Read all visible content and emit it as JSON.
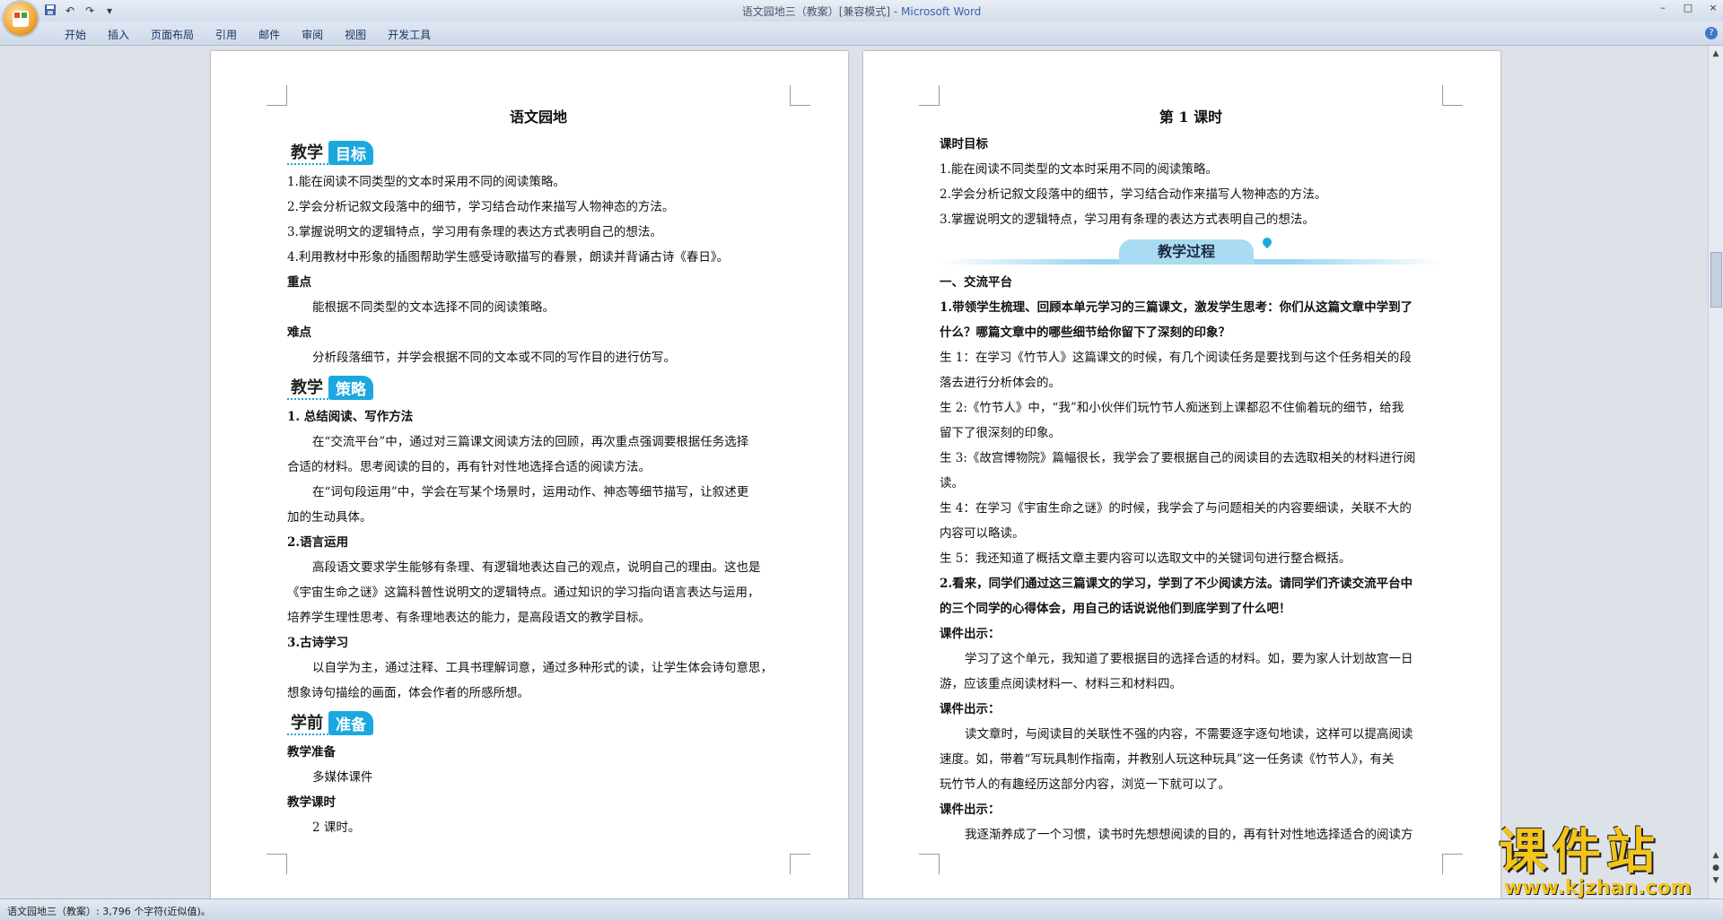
{
  "window": {
    "title_doc": "语文园地三（教案）[兼容模式] - ",
    "title_app": "Microsoft Word",
    "min": "–",
    "max": "□",
    "close": "×"
  },
  "quick_access": {
    "save_icon": "save-icon",
    "undo_icon": "undo-icon",
    "redo_icon": "redo-icon",
    "more": "▾"
  },
  "ribbon": {
    "tabs": [
      "开始",
      "插入",
      "页面布局",
      "引用",
      "邮件",
      "审阅",
      "视图",
      "开发工具"
    ],
    "help": "?"
  },
  "page1": {
    "title": "语文园地",
    "goal_banner": {
      "a": "教学",
      "b": "目标"
    },
    "goals": [
      "1.能在阅读不同类型的文本时采用不同的阅读策略。",
      "2.学会分析记叙文段落中的细节，学习结合动作来描写人物神态的方法。",
      "3.掌握说明文的逻辑特点，学习用有条理的表达方式表明自己的想法。",
      "4.利用教材中形象的插图帮助学生感受诗歌描写的春景，朗读并背诵古诗《春日》。"
    ],
    "key_label": "重点",
    "key_text": "能根据不同类型的文本选择不同的阅读策略。",
    "hard_label": "难点",
    "hard_text": "分析段落细节，并学会根据不同的文本或不同的写作目的进行仿写。",
    "strategy_banner": {
      "a": "教学",
      "b": "策略"
    },
    "s1_title": "1.  总结阅读、写作方法",
    "s1_p1a": "在“交流平台”中，通过对三篇课文阅读方法的回顾，再次重点强调要根据任务选择",
    "s1_p1b": "合适的材料。思考阅读的目的，再有针对性地选择合适的阅读方法。",
    "s1_p2a": "在“词句段运用”中，学会在写某个场景时，运用动作、神态等细节描写，让叙述更",
    "s1_p2b": "加的生动具体。",
    "s2_title": "2.语言运用",
    "s2_p1": "高段语文要求学生能够有条理、有逻辑地表达自己的观点，说明自己的理由。这也是",
    "s2_p2": "《宇宙生命之谜》这篇科普性说明文的逻辑特点。通过知识的学习指向语言表达与运用，",
    "s2_p3": "培养学生理性思考、有条理地表达的能力，是高段语文的教学目标。",
    "s3_title": "3.古诗学习",
    "s3_p1": "以自学为主，通过注释、工具书理解词意，通过多种形式的读，让学生体会诗句意思，",
    "s3_p2": "想象诗句描绘的画面，体会作者的所感所想。",
    "prep_banner": {
      "a": "学前",
      "b": "准备"
    },
    "prep_label": "教学准备",
    "prep_text": "多媒体课件",
    "hours_label": "教学课时",
    "hours_text": "2 课时。"
  },
  "page2": {
    "title": "第 1 课时",
    "goal_label": "课时目标",
    "goals": [
      "1.能在阅读不同类型的文本时采用不同的阅读策略。",
      "2.学会分析记叙文段落中的细节，学习结合动作来描写人物神态的方法。",
      "3.掌握说明文的逻辑特点，学习用有条理的表达方式表明自己的想法。"
    ],
    "process_banner": "教学过程",
    "sec1": "一、交流平台",
    "q1a": "1.带领学生梳理、回顾本单元学习的三篇课文，激发学生思考：你们从这篇文章中学到了",
    "q1b": "什么？哪篇文章中的哪些细节给你留下了深刻的印象？",
    "s1a": "生 1：在学习《竹节人》这篇课文的时候，有几个阅读任务是要找到与这个任务相关的段",
    "s1b": "落去进行分析体会的。",
    "s2a": "生 2:《竹节人》中，“我”和小伙伴们玩竹节人痴迷到上课都忍不住偷着玩的细节，给我",
    "s2b": "留下了很深刻的印象。",
    "s3a": "生 3:《故宫博物院》篇幅很长，我学会了要根据自己的阅读目的去选取相关的材料进行阅",
    "s3b": "读。",
    "s4a": "生 4：在学习《宇宙生命之谜》的时候，我学会了与问题相关的内容要细读，关联不大的",
    "s4b": "内容可以略读。",
    "s5": "生 5：我还知道了概括文章主要内容可以选取文中的关键词句进行整合概括。",
    "q2a": "2.看来，同学们通过这三篇课文的学习，学到了不少阅读方法。请同学们齐读交流平台中",
    "q2b": "的三个同学的心得体会，用自己的话说说他们到底学到了什么吧！",
    "show1": "课件出示：",
    "show1a": "学习了这个单元，我知道了要根据目的选择合适的材料。如，要为家人计划故宫一日",
    "show1b": "游，应该重点阅读材料一、材料三和材料四。",
    "show2": "课件出示：",
    "show2a": "读文章时，与阅读目的关联性不强的内容，不需要逐字逐句地读，这样可以提高阅读",
    "show2b": "速度。如，带着“写玩具制作指南，并教别人玩这种玩具”这一任务读《竹节人》，有关",
    "show2c": "玩竹节人的有趣经历这部分内容，浏览一下就可以了。",
    "show3": "课件出示：",
    "show3a": "我逐渐养成了一个习惯，读书时先想想阅读的目的，再有针对性地选择适合的阅读方"
  },
  "status": {
    "text": "语文园地三（教案）: 3,796 个字符(近似值)。"
  },
  "watermark": {
    "cn": "课件站",
    "url": "www.kjzhan.com"
  },
  "colors": {
    "accent": "#1ba8e0",
    "watermark": "#f3c41a"
  }
}
